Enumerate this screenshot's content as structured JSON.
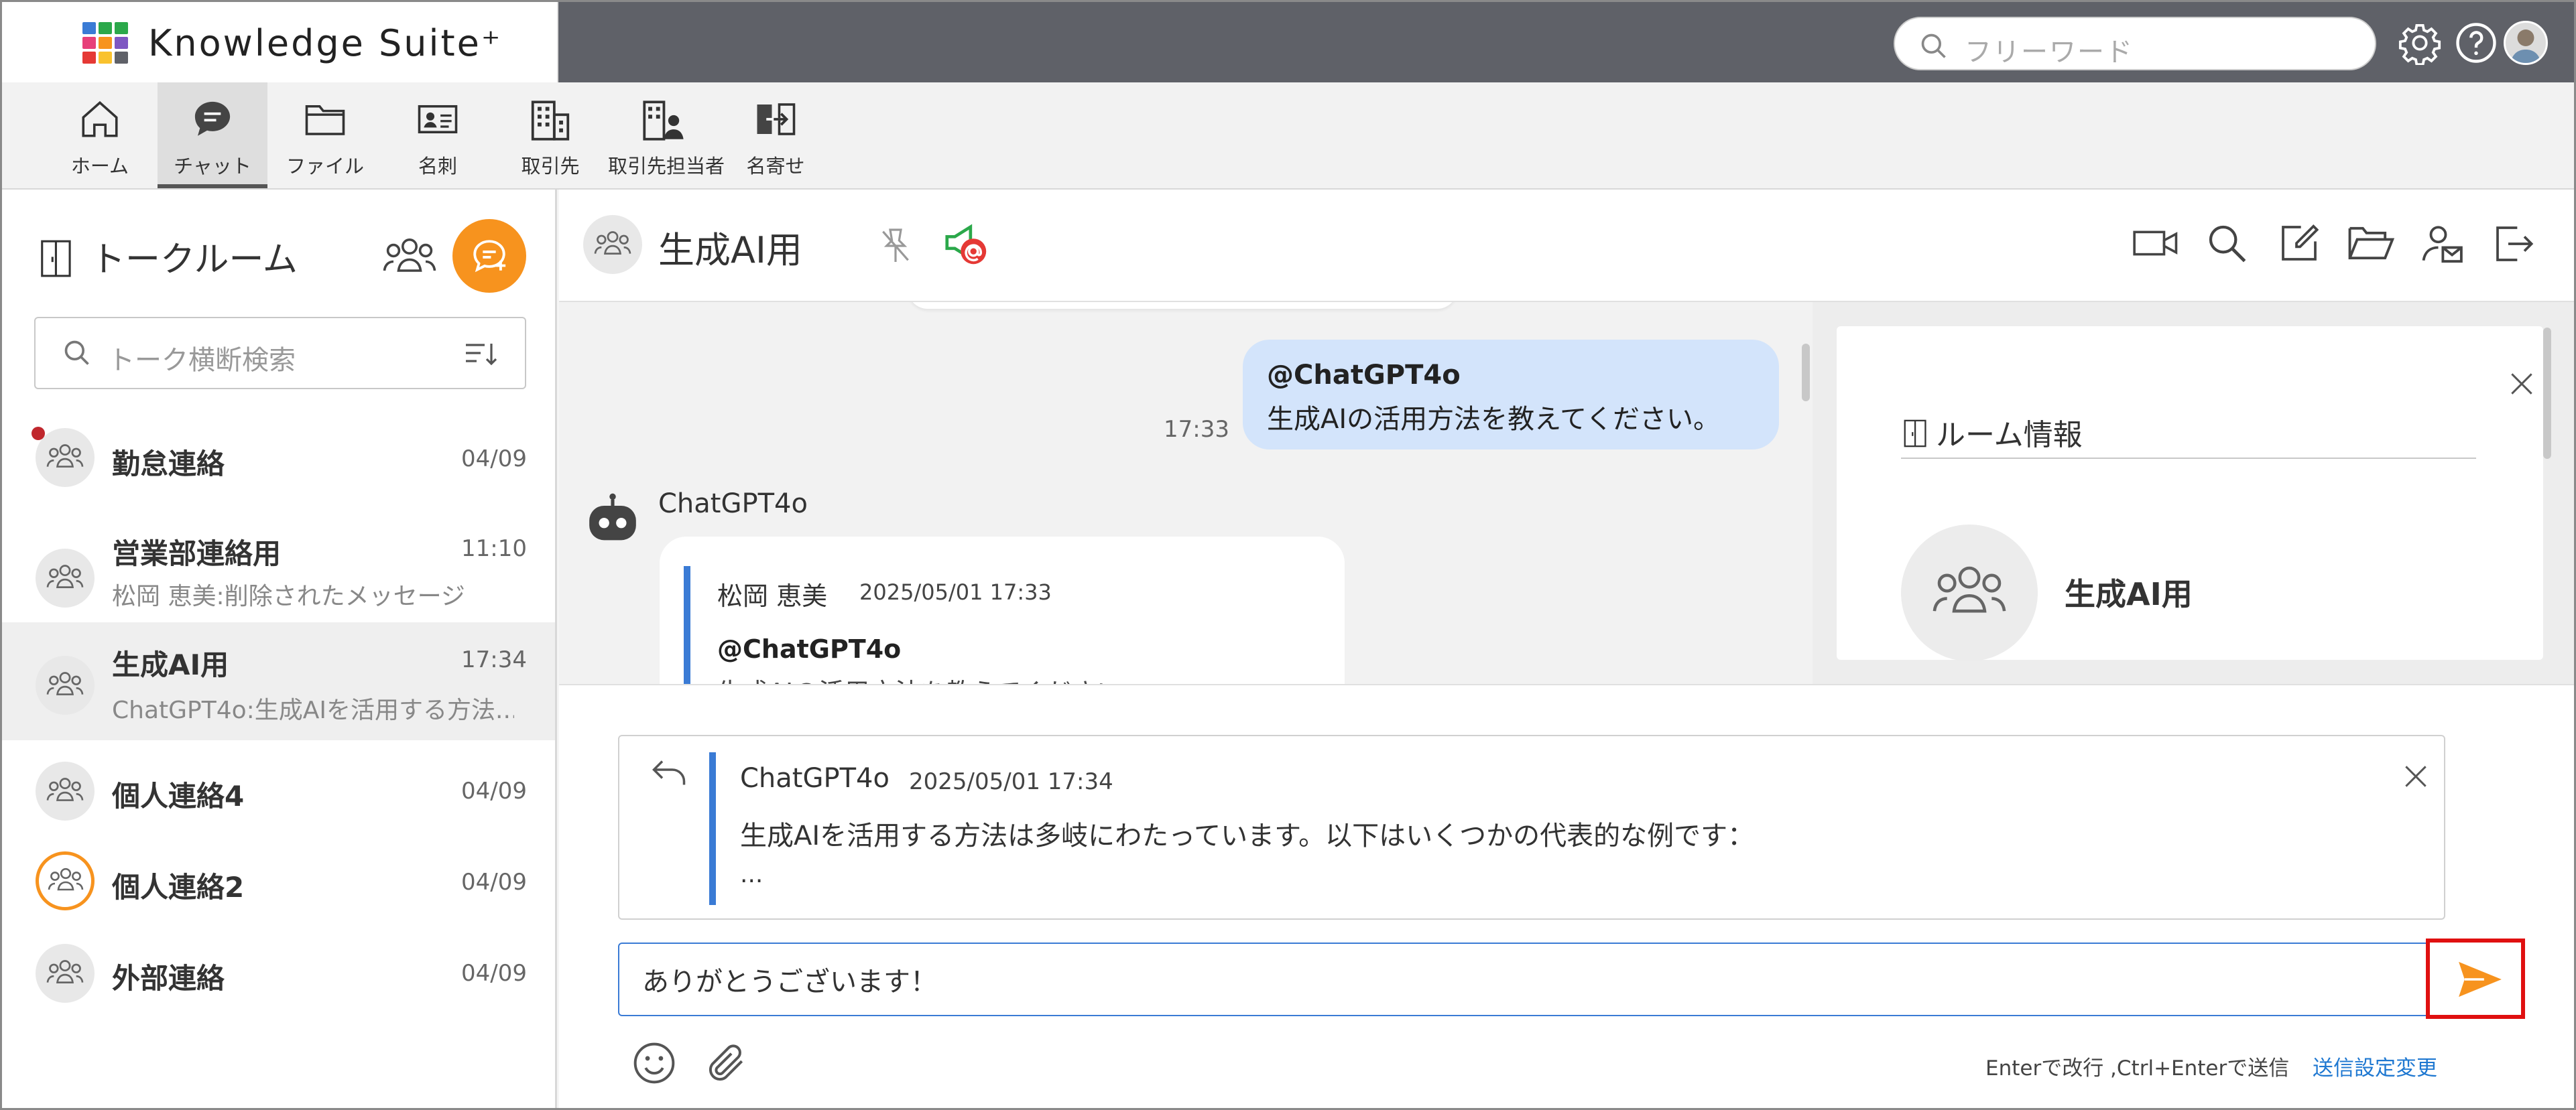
{
  "header": {
    "brand": "Knowledge Suite⁺",
    "search_placeholder": "フリーワード",
    "colors": {
      "bar": "#5f6168",
      "accent": "#f7931e",
      "link": "#1f78d1",
      "bubble_mine": "#d3e4fb"
    }
  },
  "nav": {
    "items": [
      {
        "label": "ホーム",
        "icon": "home-icon"
      },
      {
        "label": "チャット",
        "icon": "chat-icon",
        "active": true
      },
      {
        "label": "ファイル",
        "icon": "folder-icon"
      },
      {
        "label": "名刺",
        "icon": "business-card-icon"
      },
      {
        "label": "取引先",
        "icon": "building-icon"
      },
      {
        "label": "取引先担当者",
        "icon": "building-person-icon"
      },
      {
        "label": "名寄せ",
        "icon": "merge-icon"
      }
    ]
  },
  "sidebar": {
    "title": "トークルーム",
    "search_placeholder": "トーク横断検索",
    "rooms": [
      {
        "name": "勤怠連絡",
        "time": "04/09",
        "preview": "",
        "unread": true
      },
      {
        "name": "営業部連絡用",
        "time": "11:10",
        "preview": "松岡 恵美:削除されたメッセージ"
      },
      {
        "name": "生成AI用",
        "time": "17:34",
        "preview": "ChatGPT4o:生成AIを活用する方法...",
        "active": true
      },
      {
        "name": "個人連絡4",
        "time": "04/09",
        "preview": ""
      },
      {
        "name": "個人連絡2",
        "time": "04/09",
        "preview": ""
      },
      {
        "name": "外部連絡",
        "time": "04/09",
        "preview": ""
      }
    ]
  },
  "chat": {
    "title": "生成AI用",
    "my_message": {
      "mention": "@ChatGPT4o",
      "text": "生成AIの活用方法を教えてください。",
      "time": "17:33"
    },
    "bot_message": {
      "sender": "ChatGPT4o",
      "quote_author": "松岡 恵美",
      "quote_time": "2025/05/01 17:33",
      "quote_mention": "@ChatGPT4o",
      "quote_text": "生成AIの活用方法を教えてください。"
    }
  },
  "room_info": {
    "title": "ルーム情報",
    "room_name": "生成AI用"
  },
  "composer": {
    "reply_author": "ChatGPT4o",
    "reply_time": "2025/05/01 17:34",
    "reply_text": "生成AIを活用する方法は多岐にわたっています。以下はいくつかの代表的な例です：",
    "reply_ellipsis": "...",
    "input_value": "ありがとうございます！",
    "send_hint": "Enterで改行 ,Ctrl+Enterで送信",
    "send_setting_link": "送信設定変更"
  }
}
